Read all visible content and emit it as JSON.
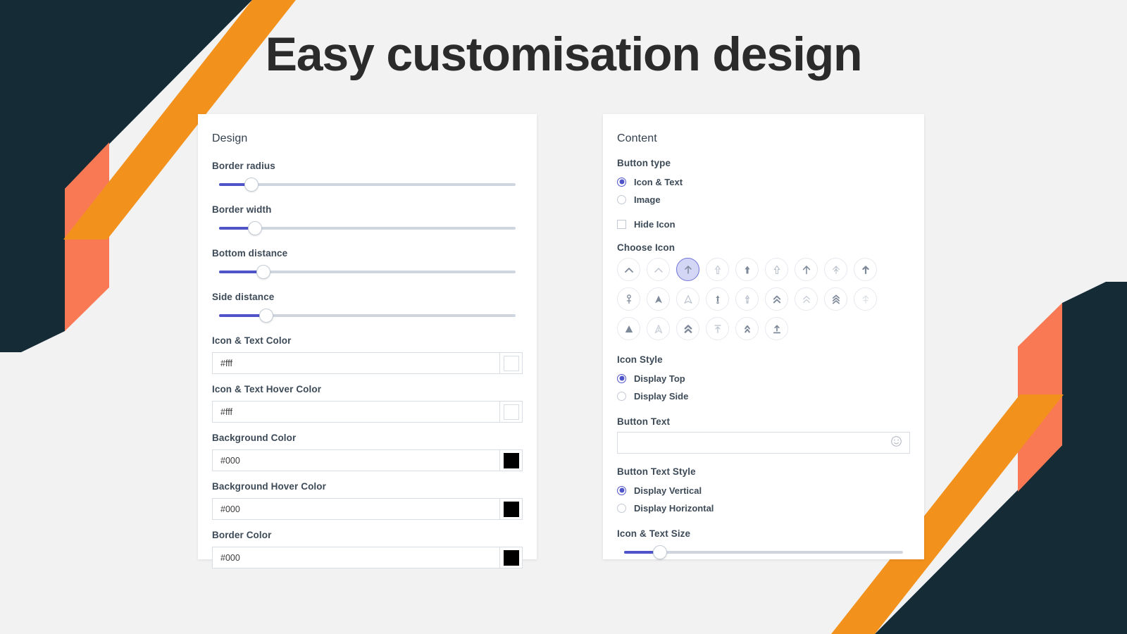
{
  "page": {
    "title": "Easy customisation design",
    "background_color": "#f2f2f3",
    "accent_navy": "#152b36",
    "accent_orange": "#f2921d",
    "accent_coral": "#f97954",
    "accent_indigo": "#4f54c8"
  },
  "design_panel": {
    "title": "Design",
    "sliders": [
      {
        "label": "Border radius",
        "fill_percent": 11
      },
      {
        "label": "Border width",
        "fill_percent": 12
      },
      {
        "label": "Bottom distance",
        "fill_percent": 15
      },
      {
        "label": "Side distance",
        "fill_percent": 16
      }
    ],
    "color_fields": [
      {
        "label": "Icon & Text Color",
        "value": "#fff",
        "swatch": "#ffffff"
      },
      {
        "label": "Icon & Text Hover Color",
        "value": "#fff",
        "swatch": "#ffffff"
      },
      {
        "label": "Background Color",
        "value": "#000",
        "swatch": "#000000"
      },
      {
        "label": "Background Hover Color",
        "value": "#000",
        "swatch": "#000000"
      },
      {
        "label": "Border Color",
        "value": "#000",
        "swatch": "#000000"
      }
    ]
  },
  "content_panel": {
    "title": "Content",
    "button_type": {
      "label": "Button type",
      "options": [
        {
          "label": "Icon & Text",
          "selected": true
        },
        {
          "label": "Image",
          "selected": false
        }
      ]
    },
    "hide_icon": {
      "label": "Hide Icon",
      "checked": false
    },
    "choose_icon": {
      "label": "Choose Icon",
      "selected_index": 2,
      "icons": [
        "chevron-up-icon",
        "chevron-up-thin-icon",
        "arrow-up-icon",
        "arrow-up-outline-thin-icon",
        "arrow-up-filled-icon",
        "arrow-up-outline-icon",
        "arrow-up-wide-icon",
        "arrow-up-sketch-icon",
        "arrow-up-bold-icon",
        "arrow-up-pin-icon",
        "triangle-up-filled-icon",
        "triangle-up-outline-icon",
        "arrow-up-pill-icon",
        "arrow-up-slim-icon",
        "double-chevron-up-icon",
        "double-chevron-up-thin-icon",
        "triple-chevron-up-icon",
        "arrow-up-faded-icon",
        "triangle-solid-icon",
        "navigation-outline-icon",
        "double-chevron-bold-icon",
        "arrow-to-top-icon",
        "double-chevron-narrow-icon",
        "upload-icon"
      ]
    },
    "icon_style": {
      "label": "Icon Style",
      "options": [
        {
          "label": "Display Top",
          "selected": true
        },
        {
          "label": "Display Side",
          "selected": false
        }
      ]
    },
    "button_text": {
      "label": "Button Text",
      "value": "",
      "placeholder": ""
    },
    "button_text_style": {
      "label": "Button Text Style",
      "options": [
        {
          "label": "Display Vertical",
          "selected": true
        },
        {
          "label": "Display Horizontal",
          "selected": false
        }
      ]
    },
    "icon_text_size": {
      "label": "Icon & Text Size",
      "fill_percent": 13
    }
  }
}
